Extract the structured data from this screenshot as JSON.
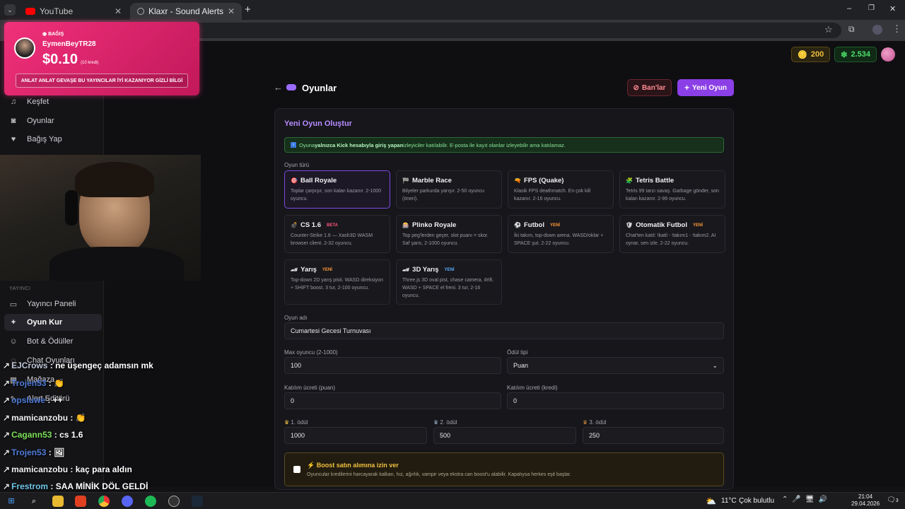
{
  "browser": {
    "tabs": [
      {
        "label": "YouTube",
        "active": false
      },
      {
        "label": "Klaxr - Sound Alerts",
        "active": true
      }
    ],
    "new_tab": "+",
    "window_controls": [
      "–",
      "❐",
      "✕"
    ]
  },
  "header": {
    "points": "200",
    "credits": "2.534"
  },
  "sidebar": {
    "items_top": [
      {
        "label": "Keşfet",
        "icon": "music-icon"
      },
      {
        "label": "Oyunlar",
        "icon": "gamepad-icon"
      },
      {
        "label": "Bağış Yap",
        "icon": "heart-icon"
      }
    ],
    "section_label": "YAYINCI",
    "items_bottom": [
      {
        "label": "Yayıncı Paneli",
        "icon": "monitor-icon"
      },
      {
        "label": "Oyun Kur",
        "icon": "plus-icon",
        "active": true
      },
      {
        "label": "Bot & Ödüller",
        "icon": "bot-icon"
      },
      {
        "label": "Chat Oyunları",
        "icon": "chat-icon"
      },
      {
        "label": "Mağaza",
        "icon": "store-icon"
      },
      {
        "label": "Alert Editörü",
        "icon": "edit-icon"
      }
    ]
  },
  "page": {
    "title": "Oyunlar",
    "ban_button": "Ban'lar",
    "new_game_button": "Yeni Oyun"
  },
  "form": {
    "title": "Yeni Oyun Oluştur",
    "notice_prefix": "Oyuna ",
    "notice_bold": "yalnızca Kick hesabıyla giriş yapan",
    "notice_suffix": " izleyiciler katılabilir. E-posta ile kayıt olanlar izleyebilir ama katılamaz.",
    "game_type_label": "Oyun türü",
    "game_types": [
      {
        "name": "Ball Royale",
        "icon": "🎯",
        "desc": "Toplar çarpışır, son kalan kazanır. 2-1000 oyuncu.",
        "badge": "",
        "selected": true
      },
      {
        "name": "Marble Race",
        "icon": "🏁",
        "desc": "Bilyeler parkurda yarışır. 2-50 oyuncu (öneri).",
        "badge": ""
      },
      {
        "name": "FPS (Quake)",
        "icon": "🔫",
        "desc": "Klasik FPS deathmatch. En çok kill kazanır. 2-16 oyuncu.",
        "badge": ""
      },
      {
        "name": "Tetris Battle",
        "icon": "🧩",
        "desc": "Tetris 99 tarzı savaş. Garbage gönder, son kalan kazanır. 2-99 oyuncu.",
        "badge": ""
      },
      {
        "name": "CS 1.6",
        "icon": "💣",
        "desc": "Counter-Strike 1.6 — Xash3D WASM browser client. 2-32 oyuncu.",
        "badge": "BETA"
      },
      {
        "name": "Plinko Royale",
        "icon": "🎰",
        "desc": "Top peg'lerden geçer, slot puanı = skor. Saf şans, 2-1000 oyuncu.",
        "badge": ""
      },
      {
        "name": "Futbol",
        "icon": "⚽",
        "desc": "İki takım, top-down arena. WASD/oklar + SPACE şut. 2-22 oyuncu.",
        "badge": "YENİ"
      },
      {
        "name": "Otomatik Futbol",
        "icon": "🛡",
        "desc": "Chat'ten katıl: !katil - !takım1 - !takım2. AI oynar, sen izle. 2-22 oyuncu.",
        "badge": "YENİ"
      },
      {
        "name": "Yarış",
        "icon": "🏎",
        "desc": "Top-down 2D yarış pisti. WASD direksiyon + SHIFT boost. 3 tur, 2-100 oyuncu.",
        "badge": "YENİ"
      },
      {
        "name": "3D Yarış",
        "icon": "🏎",
        "desc": "Three.js 3D oval pist, chase camera, drift. WASD + SPACE el freni. 3 tur, 2-16 oyuncu.",
        "badge": "YENİ"
      }
    ],
    "game_name_label": "Oyun adı",
    "game_name_value": "Cumartesi Gecesi Turnuvası",
    "max_players_label": "Max oyuncu (2-1000)",
    "max_players_value": "100",
    "reward_type_label": "Ödül tipi",
    "reward_type_value": "Puan",
    "entry_points_label": "Katılım ücreti (puan)",
    "entry_points_value": "0",
    "entry_credits_label": "Katılım ücreti (kredi)",
    "entry_credits_value": "0",
    "prizes": [
      {
        "label": "1. ödül",
        "value": "1000"
      },
      {
        "label": "2. ödül",
        "value": "500"
      },
      {
        "label": "3. ödül",
        "value": "250"
      }
    ],
    "boost_title": "Boost satın alımına izin ver",
    "boost_desc": "Oyuncular kredilerini harcayarak kalkan, hız, ağırlık, vampir veya ekstra can boost'u alabilir. Kapalıysa herkes eşit başlar."
  },
  "donation": {
    "tag": "BAĞIŞ",
    "user": "EymenBeyTR28",
    "amount": "$0.10",
    "amount_sub": "(10 kredi)",
    "message": "ANLAT ANLAT GEVAŞE BU YAYINCILAR İYİ KAZANIYOR GİZLİ BİLGİ"
  },
  "chat": [
    {
      "user": "EJCrows",
      "text": " : ne üşengeç adamsın mk",
      "color": "#bfc6d8"
    },
    {
      "user": "Trojen53",
      "text": " : 👏",
      "color": "#4f7bd8"
    },
    {
      "user": "opsluwe",
      "text": " : ++",
      "color": "#4f7bd8"
    },
    {
      "user": "mamicanzobu",
      "text": " : 👏",
      "color": "#f1f1f1"
    },
    {
      "user": "Cagann53",
      "text": " : cs 1.6",
      "color": "#7ce05a"
    },
    {
      "user": "Trojen53",
      "text": " : 🖼",
      "color": "#4f7bd8"
    },
    {
      "user": "mamicanzobu",
      "text": " : kaç para aldın",
      "color": "#f1f1f1"
    },
    {
      "user": "Frestrom",
      "text": " : SAA MİNİK DÖL GELDİ",
      "color": "#6fc4e8"
    }
  ],
  "taskbar": {
    "weather": "11°C",
    "weather_text": "Çok bulutlu",
    "time": "21:04",
    "date": "29.04.2026",
    "notifications": "3"
  },
  "colors": {
    "accent": "#8b3fe6",
    "ban_red": "#e0404a",
    "points_gold": "#f0c040",
    "credits_green": "#4ee06b",
    "donation_pink": "#f0307a"
  }
}
